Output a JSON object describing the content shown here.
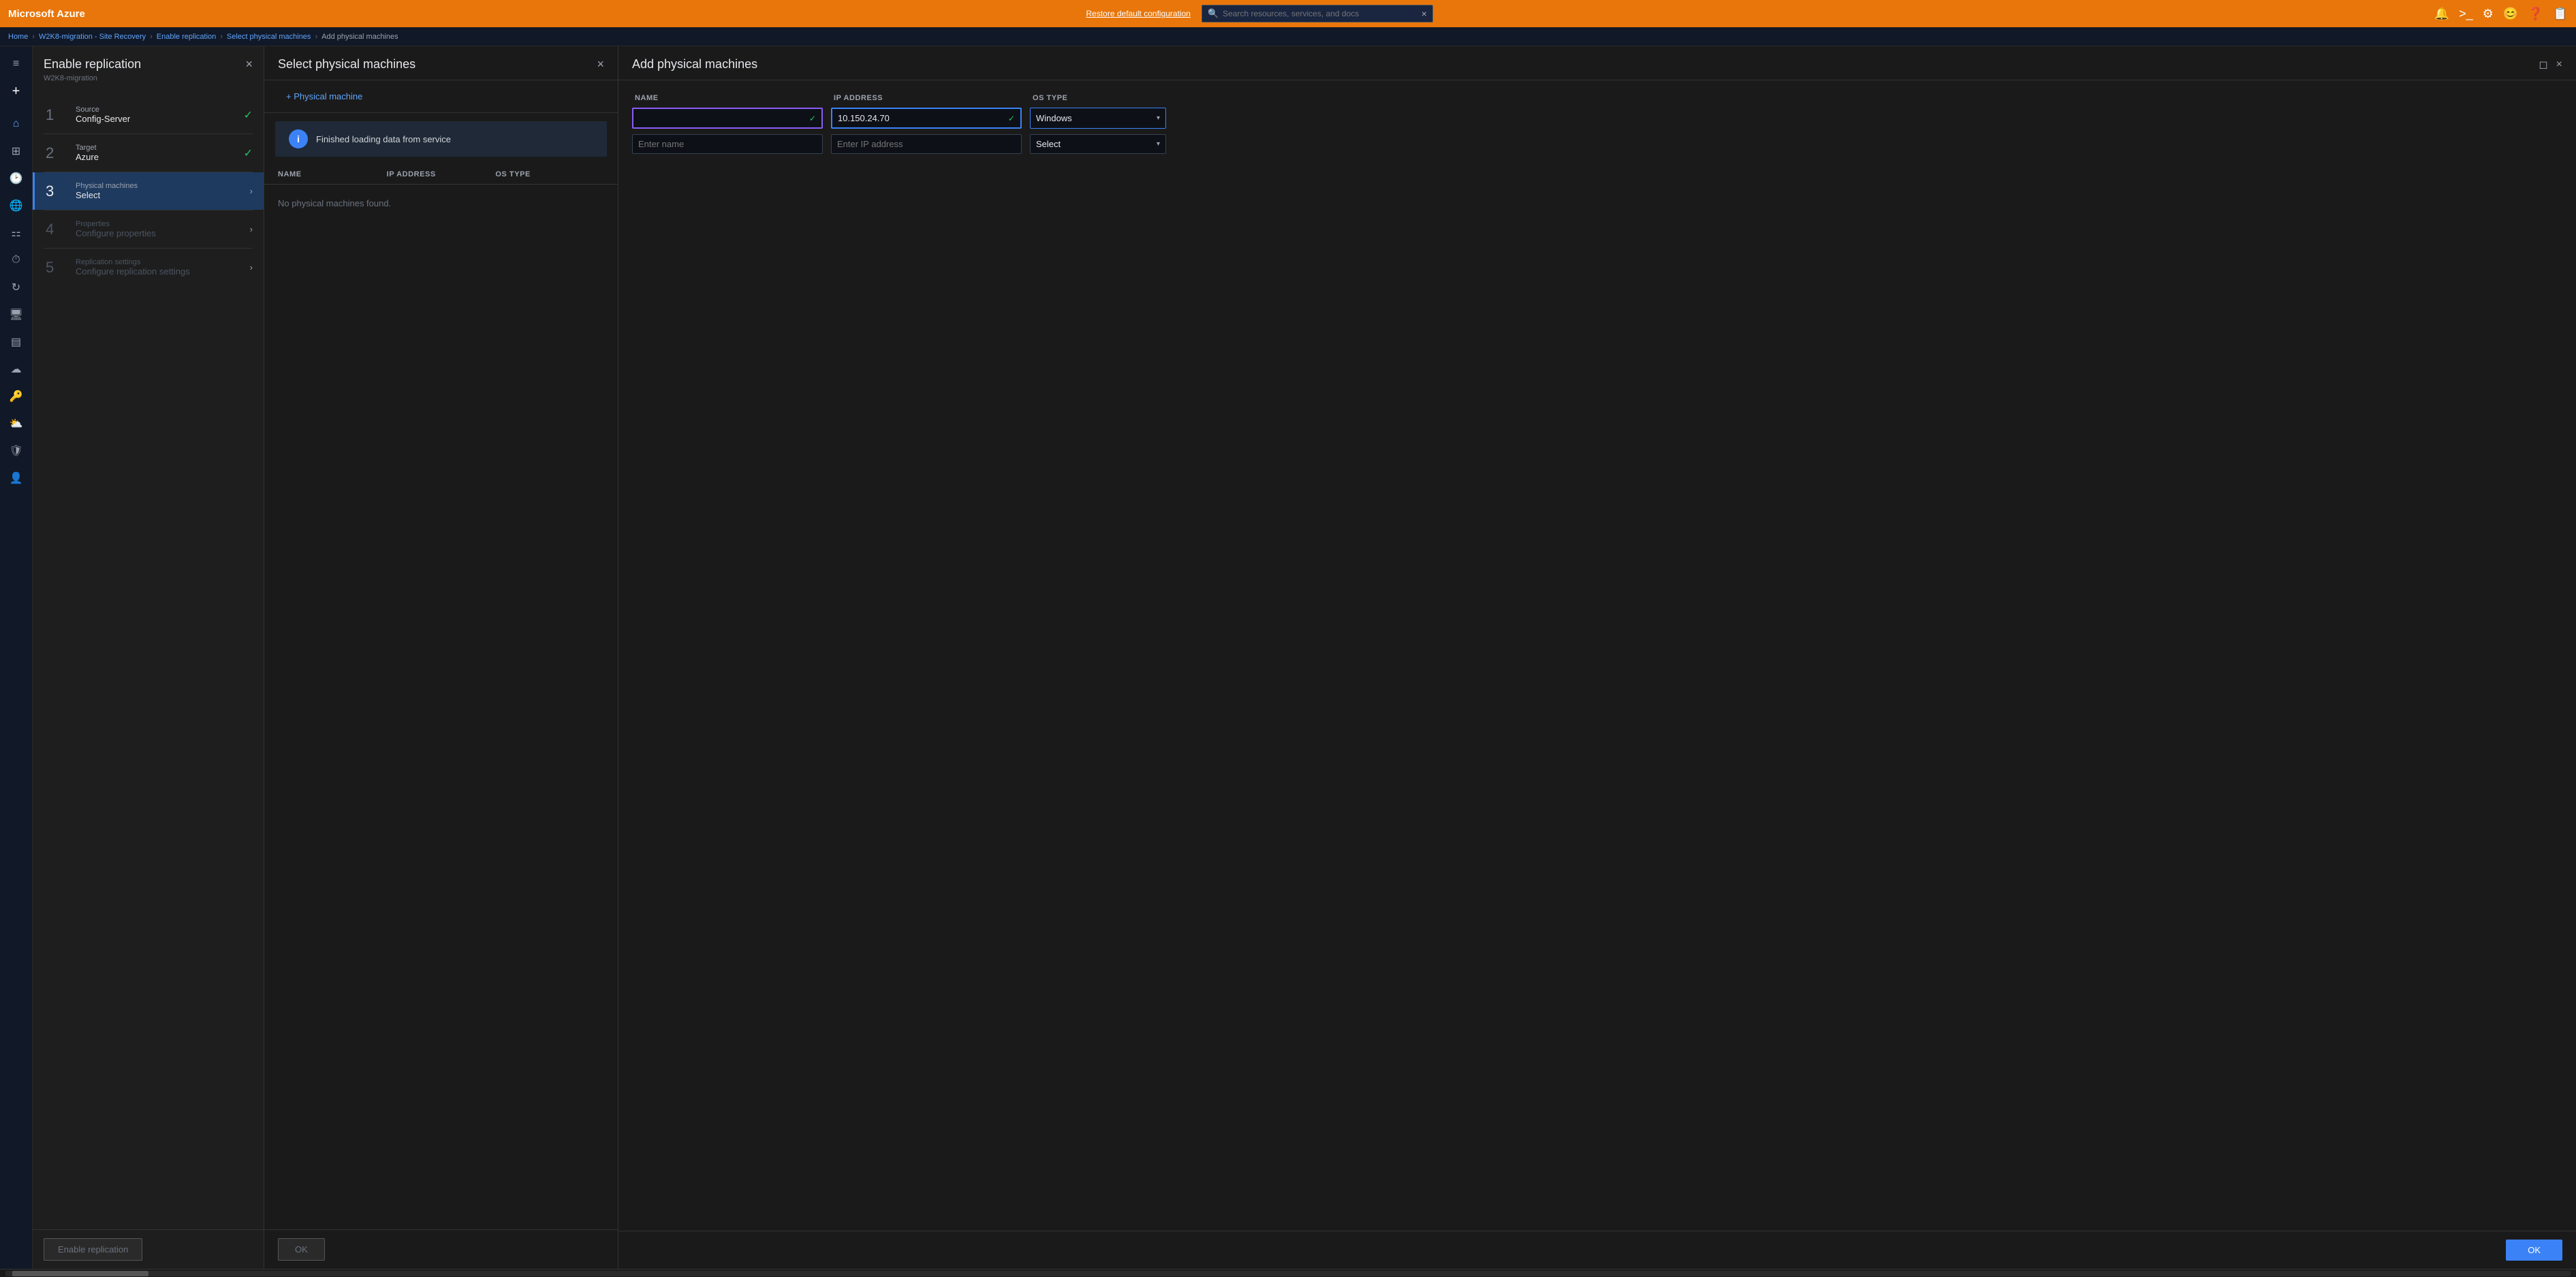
{
  "topbar": {
    "brand": "Microsoft Azure",
    "restore_link": "Restore default configuration",
    "search_placeholder": "Search resources, services, and docs"
  },
  "breadcrumb": {
    "items": [
      "Home",
      "W2K8-migration - Site Recovery",
      "Enable replication",
      "Select physical machines",
      "Add physical machines"
    ]
  },
  "sidebar": {
    "icons": [
      {
        "name": "collapse-icon",
        "symbol": "≡"
      },
      {
        "name": "plus-icon",
        "symbol": "+"
      },
      {
        "name": "favorites-icon",
        "symbol": "★"
      },
      {
        "name": "dashboard-icon",
        "symbol": "⊞"
      },
      {
        "name": "recent-icon",
        "symbol": "🕐"
      },
      {
        "name": "globe-icon",
        "symbol": "🌐"
      },
      {
        "name": "apps-icon",
        "symbol": "⊞"
      },
      {
        "name": "clock-icon",
        "symbol": "⏱"
      },
      {
        "name": "refresh-icon",
        "symbol": "↻"
      },
      {
        "name": "monitor-icon",
        "symbol": "🖥"
      },
      {
        "name": "storage-icon",
        "symbol": "💾"
      },
      {
        "name": "cloud-icon",
        "symbol": "☁"
      },
      {
        "name": "key-icon",
        "symbol": "🔑"
      },
      {
        "name": "cloud2-icon",
        "symbol": "☁"
      },
      {
        "name": "shield-icon",
        "symbol": "🛡"
      },
      {
        "name": "user-icon",
        "symbol": "👤"
      }
    ]
  },
  "enable_panel": {
    "title": "Enable replication",
    "subtitle": "W2K8-migration",
    "close_label": "×",
    "steps": [
      {
        "number": "1",
        "label": "Source",
        "value": "Config-Server",
        "state": "done"
      },
      {
        "number": "2",
        "label": "Target",
        "value": "Azure",
        "state": "done"
      },
      {
        "number": "3",
        "label": "Physical machines",
        "value": "Select",
        "state": "active"
      },
      {
        "number": "4",
        "label": "Properties",
        "value": "Configure properties",
        "state": "disabled"
      },
      {
        "number": "5",
        "label": "Replication settings",
        "value": "Configure replication settings",
        "state": "disabled"
      }
    ],
    "footer_btn": "Enable replication"
  },
  "select_panel": {
    "title": "Select physical machines",
    "close_label": "×",
    "add_btn": "+ Physical machine",
    "info_message": "Finished loading data from service",
    "table_headers": [
      "NAME",
      "IP ADDRESS",
      "OS TYPE"
    ],
    "no_data_message": "No physical machines found.",
    "ok_btn": "OK"
  },
  "add_panel": {
    "title": "Add physical machines",
    "close_label": "×",
    "minimize_label": "◻",
    "columns": [
      "NAME",
      "IP ADDRESS",
      "OS TYPE"
    ],
    "rows": [
      {
        "name_value": "",
        "name_placeholder": "",
        "ip_value": "10.150.24.70",
        "ip_placeholder": "",
        "os_value": "Windows",
        "os_placeholder": "Select"
      },
      {
        "name_value": "",
        "name_placeholder": "Enter name",
        "ip_value": "",
        "ip_placeholder": "Enter IP address",
        "os_value": "",
        "os_placeholder": "Select"
      }
    ],
    "ok_btn": "OK"
  }
}
